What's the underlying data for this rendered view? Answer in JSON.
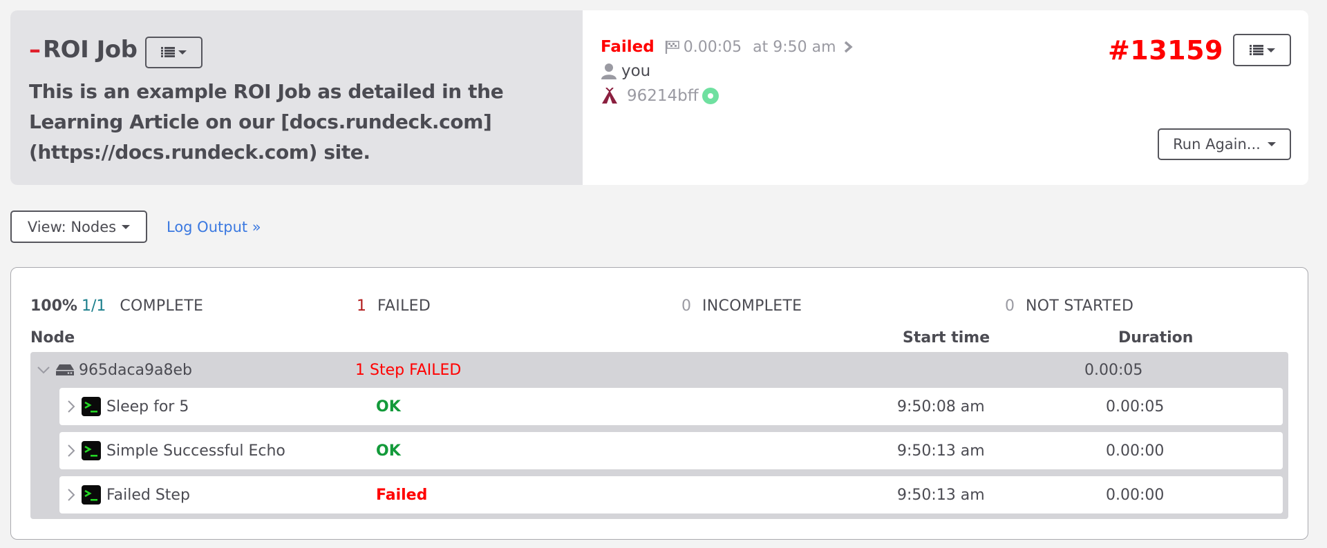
{
  "job": {
    "dash_icon": "minus-icon",
    "title": "ROI Job",
    "menu_icon": "list-icon",
    "description": "This is an example ROI Job as detailed in the Learning Article on our [docs.rundeck.com](https://docs.rundeck.com) site."
  },
  "execution": {
    "status": "Failed",
    "duration": "0.00:05",
    "finished_at": "at 9:50 am",
    "user": "you",
    "server": "96214bff",
    "id": "#13159",
    "run_again_label": "Run Again...",
    "colors": {
      "failed": "#ff0000",
      "server_dot": "#6fe0a0",
      "tent": "#8b1f3f"
    }
  },
  "toolbar": {
    "view_label": "View: Nodes",
    "log_output_label": "Log Output »"
  },
  "summary": {
    "percent": "100%",
    "ratio": "1/1",
    "complete_label": "COMPLETE",
    "failed_count": "1",
    "failed_label": "FAILED",
    "incomplete_count": "0",
    "incomplete_label": "INCOMPLETE",
    "not_started_count": "0",
    "not_started_label": "NOT STARTED"
  },
  "table": {
    "headers": {
      "node": "Node",
      "start_time": "Start time",
      "duration": "Duration"
    },
    "node": {
      "name": "965daca9a8eb",
      "status": "1 Step FAILED",
      "duration": "0.00:05"
    },
    "steps": [
      {
        "name": "Sleep for 5",
        "status": "OK",
        "start": "9:50:08 am",
        "duration": "0.00:05"
      },
      {
        "name": "Simple Successful Echo",
        "status": "OK",
        "start": "9:50:13 am",
        "duration": "0.00:00"
      },
      {
        "name": "Failed Step",
        "status": "Failed",
        "start": "9:50:13 am",
        "duration": "0.00:00"
      }
    ]
  }
}
